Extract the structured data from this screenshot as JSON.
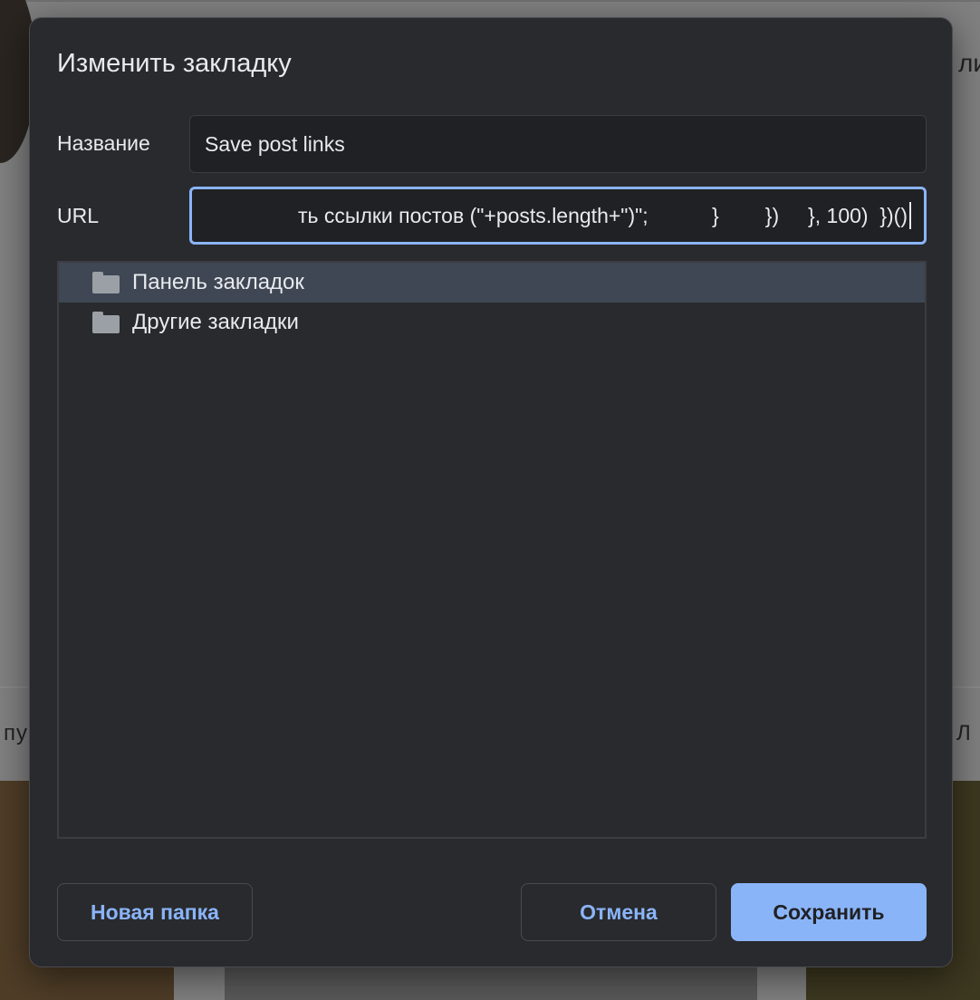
{
  "background": {
    "text_left": "пу",
    "text_right": "Л",
    "text_right_top": "ли"
  },
  "dialog": {
    "title": "Изменить закладку",
    "name_label": "Название",
    "name_value": "Save post links",
    "url_label": "URL",
    "url_value": "ть ссылки постов (\"+posts.length+\")\";           }        })     }, 100)  })()"
  },
  "folders": [
    {
      "label": "Панель закладок",
      "selected": true,
      "icon": "folder-icon"
    },
    {
      "label": "Другие закладки",
      "selected": false,
      "icon": "folder-icon"
    }
  ],
  "buttons": {
    "new_folder": "Новая папка",
    "cancel": "Отмена",
    "save": "Сохранить"
  },
  "colors": {
    "accent": "#8ab4f8",
    "dialog_bg": "#292a2d",
    "selected_row": "#3f4754"
  }
}
